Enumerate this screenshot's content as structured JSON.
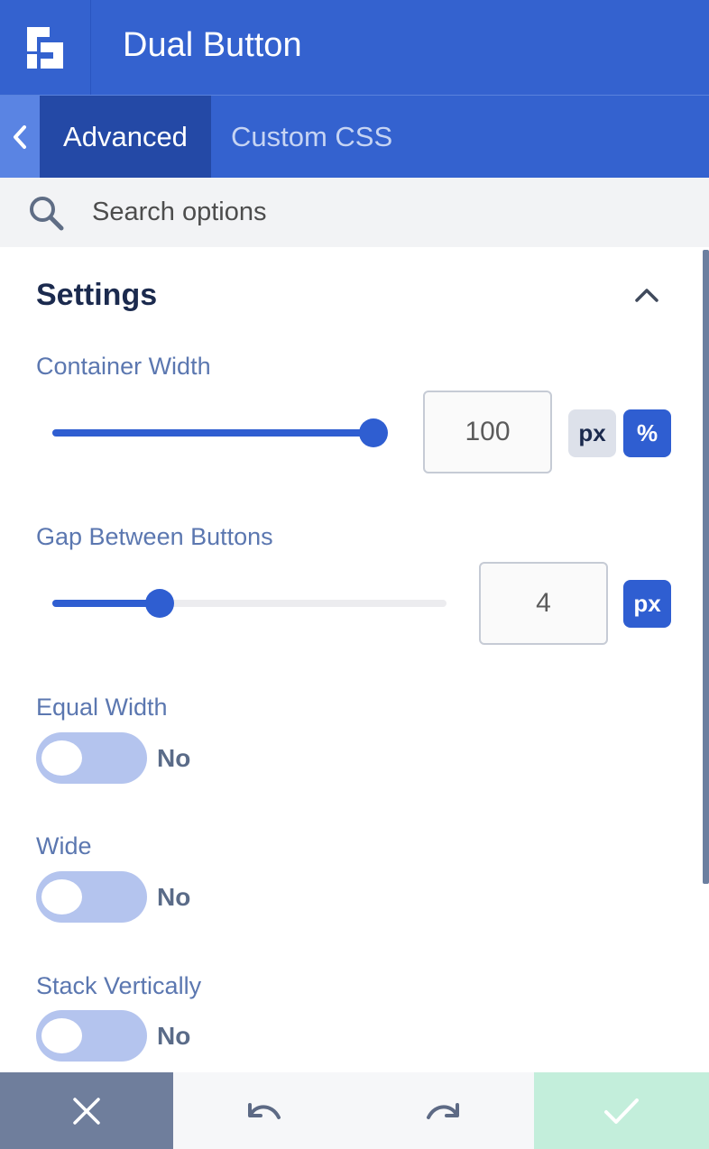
{
  "header": {
    "title": "Dual Button",
    "logo_icon": "beaver-builder-logo-icon"
  },
  "tabs": [
    {
      "label": "Advanced",
      "active": true
    },
    {
      "label": "Custom CSS",
      "active": false
    }
  ],
  "search": {
    "placeholder": "Search options"
  },
  "section": {
    "title": "Settings",
    "expanded": true
  },
  "container_width": {
    "label": "Container Width",
    "value": "100",
    "slider_fraction": 1.0,
    "units": [
      {
        "label": "px",
        "active": false
      },
      {
        "label": "%",
        "active": true
      }
    ]
  },
  "gap_between_buttons": {
    "label": "Gap Between Buttons",
    "value": "4",
    "slider_fraction": 0.27,
    "units": [
      {
        "label": "px",
        "active": true
      }
    ]
  },
  "equal_width": {
    "label": "Equal Width",
    "state": "No"
  },
  "wide": {
    "label": "Wide",
    "state": "No"
  },
  "stack_vertically": {
    "label": "Stack Vertically",
    "state": "No"
  },
  "footer": {
    "cancel_icon": "close-icon",
    "undo_icon": "undo-icon",
    "redo_icon": "redo-icon",
    "save_icon": "checkmark-icon"
  },
  "colors": {
    "header_blue": "#3462cf",
    "active_tab": "#2449a6",
    "accent": "#2f5ed1",
    "toggle_off": "#b4c4ee",
    "save_green": "#c3eedb",
    "cancel_gray": "#6f7e9c"
  }
}
